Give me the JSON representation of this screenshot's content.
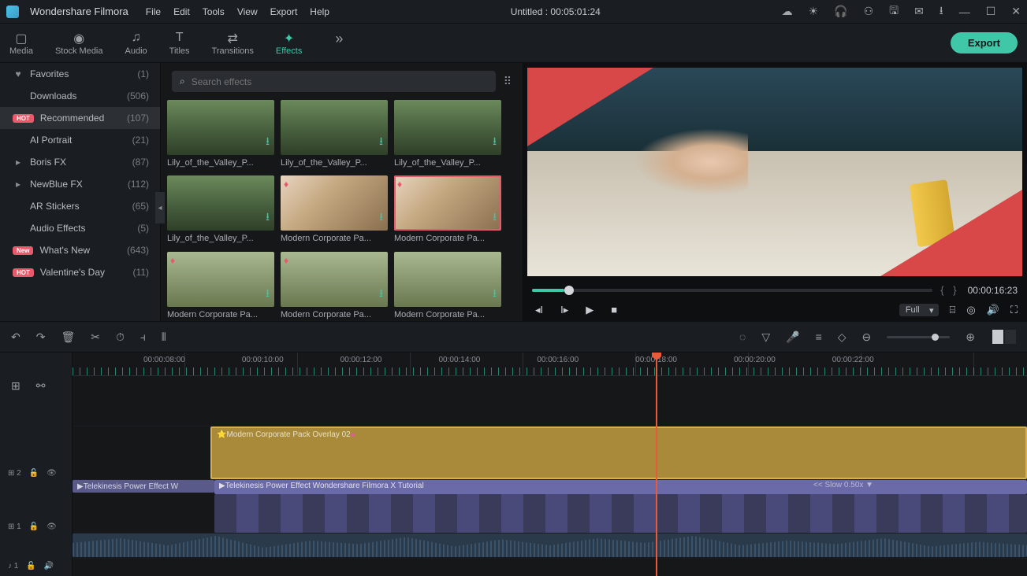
{
  "app": {
    "name": "Wondershare Filmora",
    "title": "Untitled : 00:05:01:24"
  },
  "menu": [
    "File",
    "Edit",
    "Tools",
    "View",
    "Export",
    "Help"
  ],
  "tabs": [
    {
      "label": "Media",
      "icon": "▢"
    },
    {
      "label": "Stock Media",
      "icon": "◉"
    },
    {
      "label": "Audio",
      "icon": "♫"
    },
    {
      "label": "Titles",
      "icon": "T"
    },
    {
      "label": "Transitions",
      "icon": "⇄"
    },
    {
      "label": "Effects",
      "icon": "✦",
      "active": true
    }
  ],
  "export_label": "Export",
  "sidebar": [
    {
      "icon": "♥",
      "label": "Favorites",
      "count": "(1)"
    },
    {
      "icon": "",
      "label": "Downloads",
      "count": "(506)"
    },
    {
      "badge": "HOT",
      "label": "Recommended",
      "count": "(107)",
      "active": true
    },
    {
      "icon": "",
      "label": "AI Portrait",
      "count": "(21)"
    },
    {
      "icon": "▸",
      "label": "Boris FX",
      "count": "(87)"
    },
    {
      "icon": "▸",
      "label": "NewBlue FX",
      "count": "(112)"
    },
    {
      "icon": "",
      "label": "AR Stickers",
      "count": "(65)"
    },
    {
      "icon": "",
      "label": "Audio Effects",
      "count": "(5)"
    },
    {
      "badge": "New",
      "label": "What's New",
      "count": "(643)"
    },
    {
      "badge": "HOT",
      "label": "Valentine's Day",
      "count": "(11)"
    }
  ],
  "search": {
    "placeholder": "Search effects"
  },
  "effects": [
    {
      "name": "Lily_of_the_Valley_P...",
      "style": "forest"
    },
    {
      "name": "Lily_of_the_Valley_P...",
      "style": "forest"
    },
    {
      "name": "Lily_of_the_Valley_P...",
      "style": "forest"
    },
    {
      "name": "Lily_of_the_Valley_P...",
      "style": "forest"
    },
    {
      "name": "Modern Corporate Pa...",
      "style": "corp",
      "fav": true
    },
    {
      "name": "Modern Corporate Pa...",
      "style": "corp",
      "fav": true,
      "selected": true
    },
    {
      "name": "Modern Corporate Pa...",
      "style": "field",
      "fav": true
    },
    {
      "name": "Modern Corporate Pa...",
      "style": "field",
      "fav": true
    },
    {
      "name": "Modern Corporate Pa...",
      "style": "field"
    }
  ],
  "preview": {
    "markers": "{  }",
    "timecode": "00:00:16:23",
    "quality": "Full"
  },
  "ruler": [
    "00:00:08:00",
    "00:00:10:00",
    "00:00:12:00",
    "00:00:14:00",
    "00:00:16:00",
    "00:00:18:00",
    "00:00:20:00",
    "00:00:22:00"
  ],
  "tracks": {
    "overlay_label": "Modern Corporate Pack Overlay 02",
    "video1_label": "Telekinesis Power Effect  W",
    "video2_label": "Telekinesis Power Effect  Wondershare Filmora X Tutorial",
    "slow": "<< Slow 0.50x  ▼",
    "t2": "⊞ 2",
    "t1": "⊞ 1",
    "ta": "♪ 1"
  }
}
